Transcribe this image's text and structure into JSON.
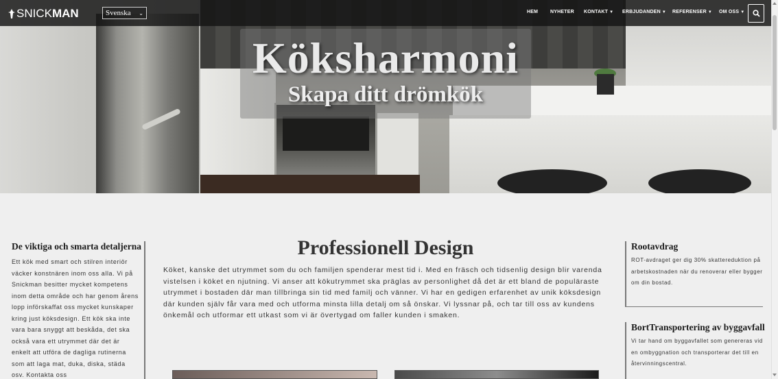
{
  "nav": {
    "logo_prefix": "SNICK",
    "logo_suffix": "MAN",
    "language": "Svenska",
    "items": [
      {
        "label": "HEM",
        "dropdown": false
      },
      {
        "label": "NYHETER",
        "dropdown": false
      },
      {
        "label": "KONTAKT",
        "dropdown": true
      },
      {
        "label": "ERBJUDANDEN",
        "dropdown": true
      },
      {
        "label": "REFERENSER",
        "dropdown": true
      },
      {
        "label": "OM OSS",
        "dropdown": true
      }
    ],
    "search_icon": "search-icon"
  },
  "hero": {
    "title": "Köksharmoni",
    "subtitle": "Skapa ditt drömkök"
  },
  "left": {
    "title": "De viktiga och smarta detaljerna",
    "text": "Ett kök med smart och stilren interiör väcker konstnären inom oss alla. Vi på Snickman besitter mycket kompetens inom detta område och har genom årens lopp införskaffat oss mycket kunskaper kring just köksdesign. Ett kök ska inte vara bara snyggt att beskåda, det ska också vara ett utrymmet där det är enkelt att utföra de dagliga rutinerna som att laga mat, duka, diska, städa osv. Kontakta oss"
  },
  "main": {
    "title": "Professionell Design",
    "text": "Köket, kanske det utrymmet som du och familjen spenderar mest tid i. Med en fräsch och tidsenlig design blir varenda vistelsen i köket en njutning. Vi anser att kökutrymmet ska präglas av personlighet då det är ett bland de populäraste utrymmet i bostaden där man tillbringa sin tid med familj och vänner. Vi har en gedigen erfarenhet av unik köksdesign där kunden själv får vara med och utforma minsta lilla detalj om så önskar. Vi lyssnar på, och tar till oss av kundens önkemål och utformar ett utkast som vi är övertygad om faller kunden i smaken."
  },
  "cards": [
    {
      "title": "Rootavdrag",
      "text": "ROT-avdraget ger dig 30% skattereduktion på arbetskostnaden när du renoverar eller bygger om din bostad."
    },
    {
      "title": "BortTransportering av byggavfall",
      "text": "Vi tar hand om byggavfallet som genereras vid en ombyggnation och transporterar det till en återvinningscentral."
    }
  ]
}
